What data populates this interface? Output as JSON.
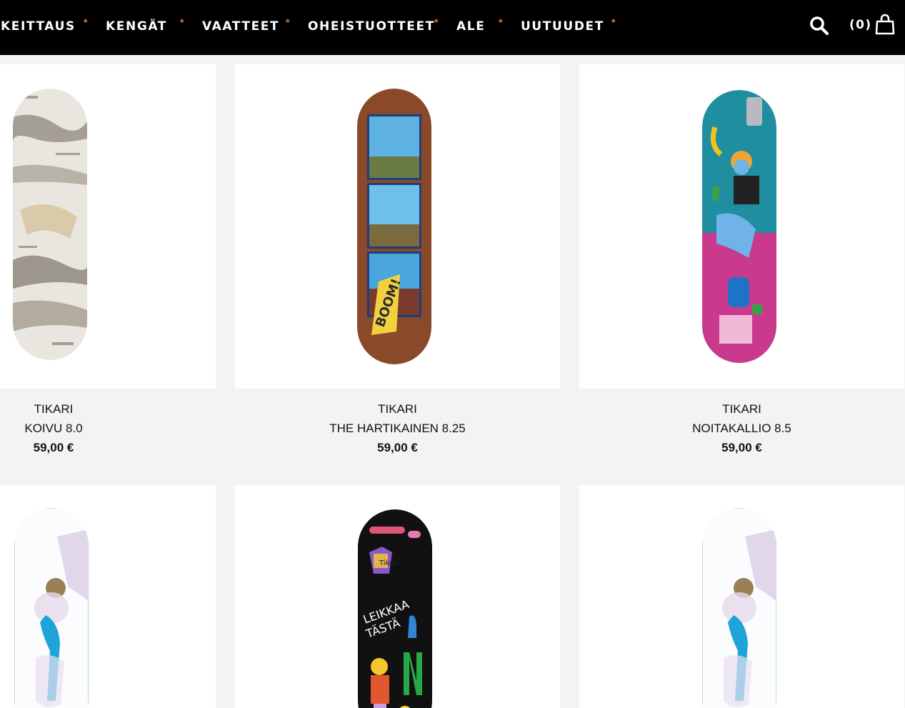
{
  "nav": {
    "items": [
      "KEITTAUS",
      "KENGÄT",
      "VAATTEET",
      "OHEISTUOTTEET",
      "ALE",
      "UUTUUDET"
    ],
    "separator": "*",
    "cart_count": "(0)",
    "accent_color": "#e0792c"
  },
  "products": [
    {
      "brand": "TIKARI",
      "name": "KOIVU 8.0",
      "price": "59,00 €",
      "artwork": "birch-bark"
    },
    {
      "brand": "TIKARI",
      "name": "THE HARTIKAINEN 8.25",
      "price": "59,00 €",
      "artwork": "wood-comic-boom"
    },
    {
      "brand": "TIKARI",
      "name": "NOITAKALLIO 8.5",
      "price": "59,00 €",
      "artwork": "teal-witch-illustration"
    },
    {
      "artwork": "white-watercolor-figure"
    },
    {
      "artwork": "black-kids-drawings"
    },
    {
      "artwork": "white-watercolor-figure"
    }
  ],
  "icons": {
    "search": "search-icon",
    "cart": "shopping-bag-icon"
  }
}
